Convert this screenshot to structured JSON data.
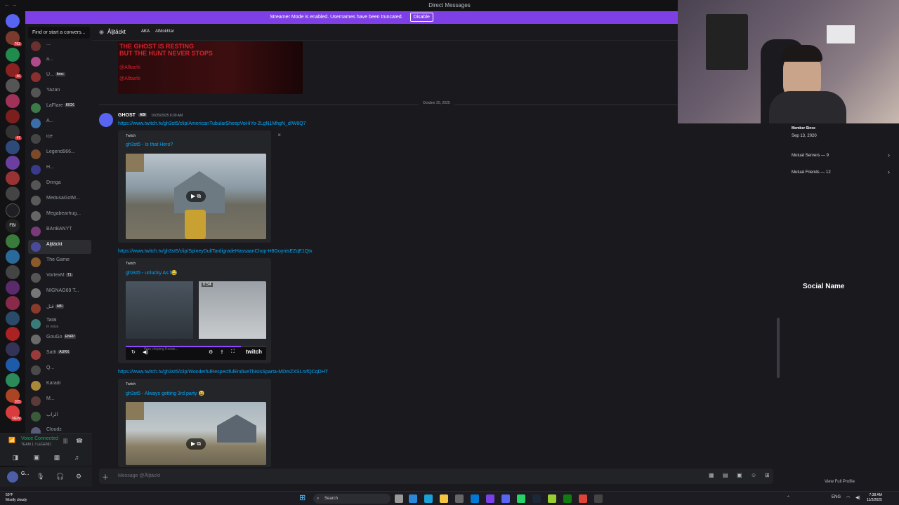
{
  "window": {
    "title": "Direct Messages"
  },
  "banner": {
    "text": "Streamer Mode is enabled. Usernames have been truncated.",
    "disable_label": "Disable"
  },
  "guild_badges": [
    "762",
    "46",
    "47",
    "16",
    "105",
    "NEW"
  ],
  "dm_search_placeholder": "Find or start a convers...",
  "dms": [
    {
      "name": "...",
      "tag": "",
      "status": ""
    },
    {
      "name": "a...",
      "tag": "",
      "status": ""
    },
    {
      "name": "U...",
      "tag": "broc",
      "status": ""
    },
    {
      "name": "Yazan",
      "tag": "",
      "status": ""
    },
    {
      "name": "LaFlare",
      "tag": "KICK",
      "status": ""
    },
    {
      "name": "A...",
      "tag": "",
      "status": ""
    },
    {
      "name": "ice",
      "tag": "",
      "status": ""
    },
    {
      "name": "Legend966...",
      "tag": "",
      "status": ""
    },
    {
      "name": "H...",
      "tag": "",
      "status": ""
    },
    {
      "name": "Dringa",
      "tag": "",
      "status": ""
    },
    {
      "name": "MedusaGotM...",
      "tag": "",
      "status": ""
    },
    {
      "name": "Megabearhug...",
      "tag": "",
      "status": ""
    },
    {
      "name": "BAriBANYT",
      "tag": "",
      "status": ""
    },
    {
      "name": "Åljtäckt",
      "tag": "",
      "status": ""
    },
    {
      "name": "The Game",
      "tag": "",
      "status": ""
    },
    {
      "name": "VortexM",
      "tag": "T1",
      "status": ""
    },
    {
      "name": "NIGNAG69 T...",
      "tag": "",
      "status": ""
    },
    {
      "name": "قتل",
      "tag": "ABI",
      "status": ""
    },
    {
      "name": "Talal",
      "tag": "",
      "status": "In voice"
    },
    {
      "name": "GouGo",
      "tag": "ENRP",
      "status": ""
    },
    {
      "name": "Sath",
      "tag": "AURX",
      "status": ""
    },
    {
      "name": "Q...",
      "tag": "",
      "status": ""
    },
    {
      "name": "Karadi",
      "tag": "",
      "status": ""
    },
    {
      "name": "M...",
      "tag": "",
      "status": ""
    },
    {
      "name": "الراب",
      "tag": "",
      "status": ""
    },
    {
      "name": "Cloudz",
      "tag": "",
      "status": ""
    }
  ],
  "voice": {
    "status": "Voice Connected",
    "channel": "TEAM 1 / LEGEND"
  },
  "user": {
    "name": "G..."
  },
  "chat": {
    "recipient": "Åljtäckt",
    "aka_label": "AKA",
    "aka_name": "AlMokhtar",
    "poster": {
      "line1": "THE GHOST IS RESTING",
      "line2": "BUT THE HUNT NEVER STOPS",
      "handle1": "@Alltachi",
      "handle2": "@Alltachi"
    },
    "date_divider": "October 25, 2025",
    "message": {
      "author": "GHOST",
      "author_tag": "ABI",
      "timestamp": "10/25/2025 6:30 AM",
      "embeds": [
        {
          "link": "https://www.twitch.tv/gh3st5/clip/AmericanTubularSheepVoHiYo-2LgN1MhgN_dIW8Q7",
          "provider": "Twitch",
          "title": "gh3st5 - Is that Hero?"
        },
        {
          "link": "https://www.twitch.tv/gh3st5/clip/SpineyDullTardigradeHassaanChop-H8GoynisEZqE1Qtx",
          "provider": "Twitch",
          "title": "gh3st5 - unlucky As f😂",
          "duration": "0:54",
          "caption": "Was chirping Kodak...",
          "brand": "twitch"
        },
        {
          "link": "https://www.twitch.tv/gh3st5/clip/WonderfulRespectfulEndiveThisIsSparta-MDmZXSLrxfQCqDHT",
          "provider": "Twitch",
          "title": "gh3st5 - Always getting 3rd party 😄"
        }
      ]
    },
    "composer_placeholder": "Message @Åljtäckt"
  },
  "profile": {
    "member_since_label": "Member Since",
    "member_since": "Sep 13, 2020",
    "mutual_servers": "Mutual Servers — 9",
    "mutual_friends": "Mutual Friends — 12",
    "social_name": "Social Name",
    "view_full": "View Full Profile"
  },
  "taskbar": {
    "weather_temp": "50°F",
    "weather_desc": "Mostly cloudy",
    "search": "Search",
    "lang": "ENG",
    "time": "7:38 AM",
    "date": "11/2/2025"
  }
}
